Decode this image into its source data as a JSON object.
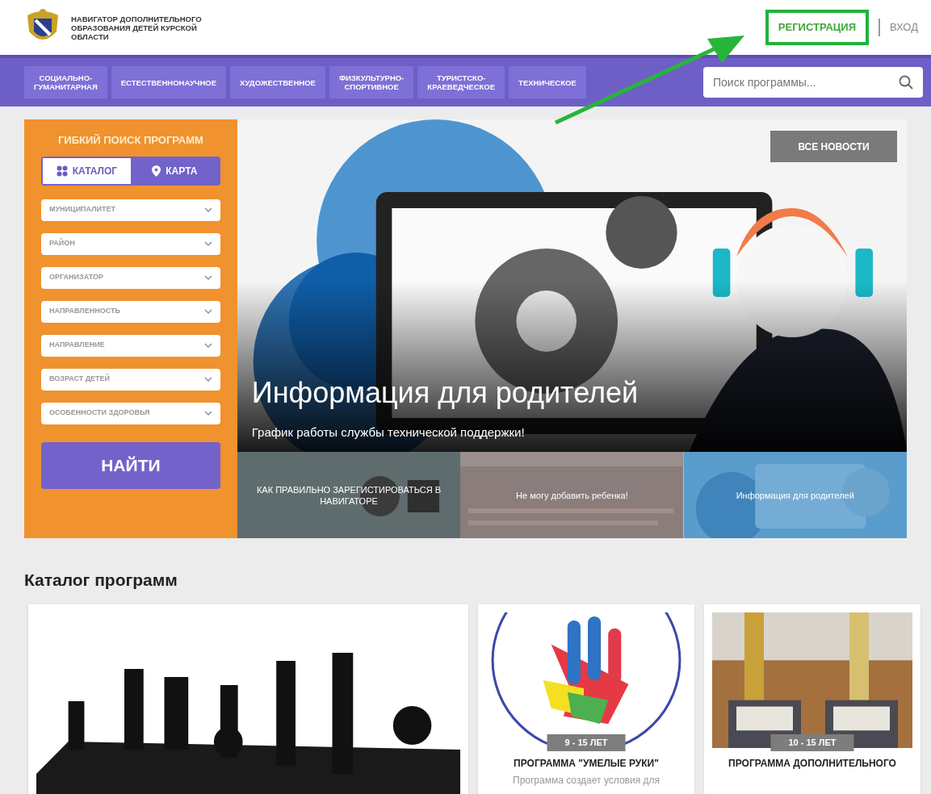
{
  "header": {
    "logo_title": "НАВИГАТОР ДОПОЛНИТЕЛЬНОГО ОБРАЗОВАНИЯ ДЕТЕЙ КУРСКОЙ ОБЛАСТИ",
    "links": [
      {
        "label": "РЕГИСТРАЦИЯ",
        "highlighted": true
      },
      {
        "label": "ВХОД",
        "highlighted": false
      }
    ]
  },
  "nav": {
    "items": [
      "СОЦИАЛЬНО-\nГУМАНИТАРНАЯ",
      "ЕСТЕСТВЕННОНАУЧНОЕ",
      "ХУДОЖЕСТВЕННОЕ",
      "ФИЗКУЛЬТУРНО-\nСПОРТИВНОЕ",
      "ТУРИСТСКО-\nКРАЕВЕДЧЕСКОЕ",
      "ТЕХНИЧЕСКОЕ"
    ],
    "search": {
      "placeholder": "Поиск программы..."
    }
  },
  "filter": {
    "title": "ГИБКИЙ ПОИСК ПРОГРАММ",
    "tabs": [
      {
        "label": "КАТАЛОГ",
        "kind": "grid",
        "selected": true
      },
      {
        "label": "КАРТА",
        "kind": "pin",
        "selected": false
      }
    ],
    "selects": [
      "МУНИЦИПАЛИТЕТ",
      "РАЙОН",
      "ОРГАНИЗАТОР",
      "НАПРАВЛЕННОСТЬ",
      "НАПРАВЛЕНИЕ",
      "ВОЗРАСТ ДЕТЕЙ",
      "ОСОБЕННОСТИ ЗДОРОВЬЯ"
    ],
    "button": "НАЙТИ"
  },
  "hero": {
    "news_button": "ВСЕ НОВОСТИ",
    "title": "Информация для родителей",
    "subtitle": "График работы службы технической поддержки!",
    "tiles": [
      {
        "title": "КАК ПРАВИЛЬНО ЗАРЕГИСТИРОВАТЬСЯ В НАВИГАТОРЕ",
        "kind": "info"
      },
      {
        "title": "Не могу добавить ребенка!",
        "kind": "screen"
      },
      {
        "title": "Информация для родителей",
        "kind": "support"
      }
    ]
  },
  "catalog": {
    "heading": "Каталог программ",
    "cards": [
      {
        "kind": "chess"
      },
      {
        "kind": "hand",
        "age": "9 - 15 ЛЕТ",
        "title": "ПРОГРАММА \"УМЕЛЫЕ РУКИ\"",
        "description": "Программа создает условия для"
      },
      {
        "kind": "cups",
        "age": "10 - 15 ЛЕТ",
        "title": "ПРОГРАММА ДОПОЛНИТЕЛЬНОГО"
      }
    ]
  }
}
